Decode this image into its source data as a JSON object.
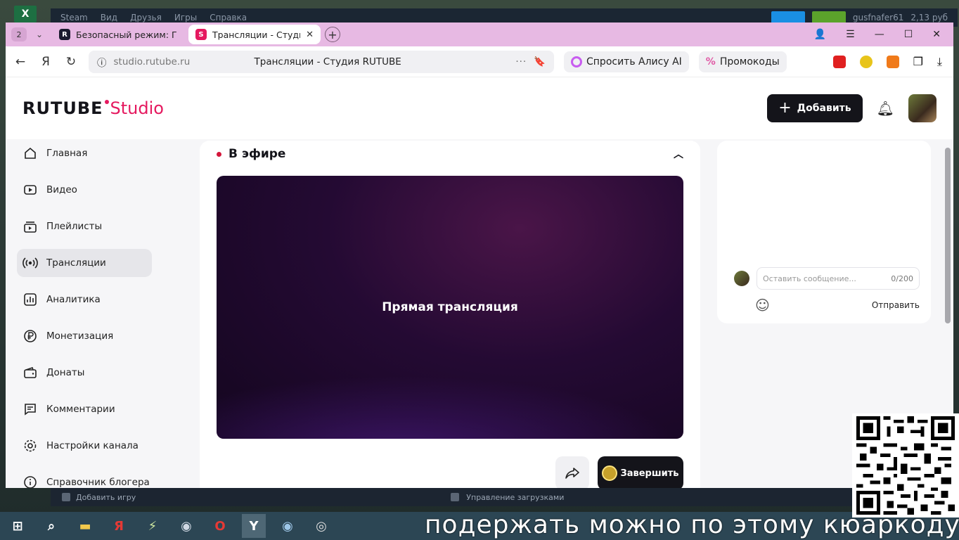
{
  "desktop": {
    "steam_menu": [
      "Steam",
      "Вид",
      "Друзья",
      "Игры",
      "Справка"
    ],
    "steam_user": "gusfnafer61",
    "steam_balance": "2,13 руб",
    "steam_footer_add_game": "Добавить игру",
    "steam_footer_downloads": "Управление загрузками",
    "overlay_text": "подержать можно по этому кюаркоду"
  },
  "browser": {
    "tab_count": "2",
    "tabs": [
      {
        "title": "Безопасный режим: Главная",
        "active": false
      },
      {
        "title": "Трансляции - Студия RUTUBE",
        "active": true
      }
    ],
    "url": "studio.rutube.ru",
    "page_title": "Трансляции - Студия RUTUBE",
    "alice_label": "Спросить Алису AI",
    "promo_label": "Промокоды"
  },
  "header": {
    "logo_rutube": "RUTUBE",
    "logo_studio": "Studio",
    "add_label": "Добавить"
  },
  "sidebar": {
    "items": [
      {
        "label": "Главная",
        "icon": "home-icon"
      },
      {
        "label": "Видео",
        "icon": "video-icon"
      },
      {
        "label": "Плейлисты",
        "icon": "playlist-icon"
      },
      {
        "label": "Трансляции",
        "icon": "broadcast-icon",
        "active": true
      },
      {
        "label": "Аналитика",
        "icon": "analytics-icon"
      },
      {
        "label": "Монетизация",
        "icon": "ruble-icon"
      },
      {
        "label": "Донаты",
        "icon": "wallet-icon"
      },
      {
        "label": "Комментарии",
        "icon": "comment-icon"
      },
      {
        "label": "Настройки канала",
        "icon": "gear-icon"
      },
      {
        "label": "Справочник блогера",
        "icon": "info-icon"
      }
    ]
  },
  "live": {
    "status": "В эфире",
    "player_title": "Прямая трансляция",
    "finish_label": "Завершить"
  },
  "chat": {
    "placeholder": "Оставить сообщение...",
    "counter": "0/200",
    "send_label": "Отправить"
  },
  "colors": {
    "accent": "#e5195f",
    "live_dot": "#d4163a",
    "dark_button": "#14141a",
    "tabbar": "#e7b9e3"
  }
}
